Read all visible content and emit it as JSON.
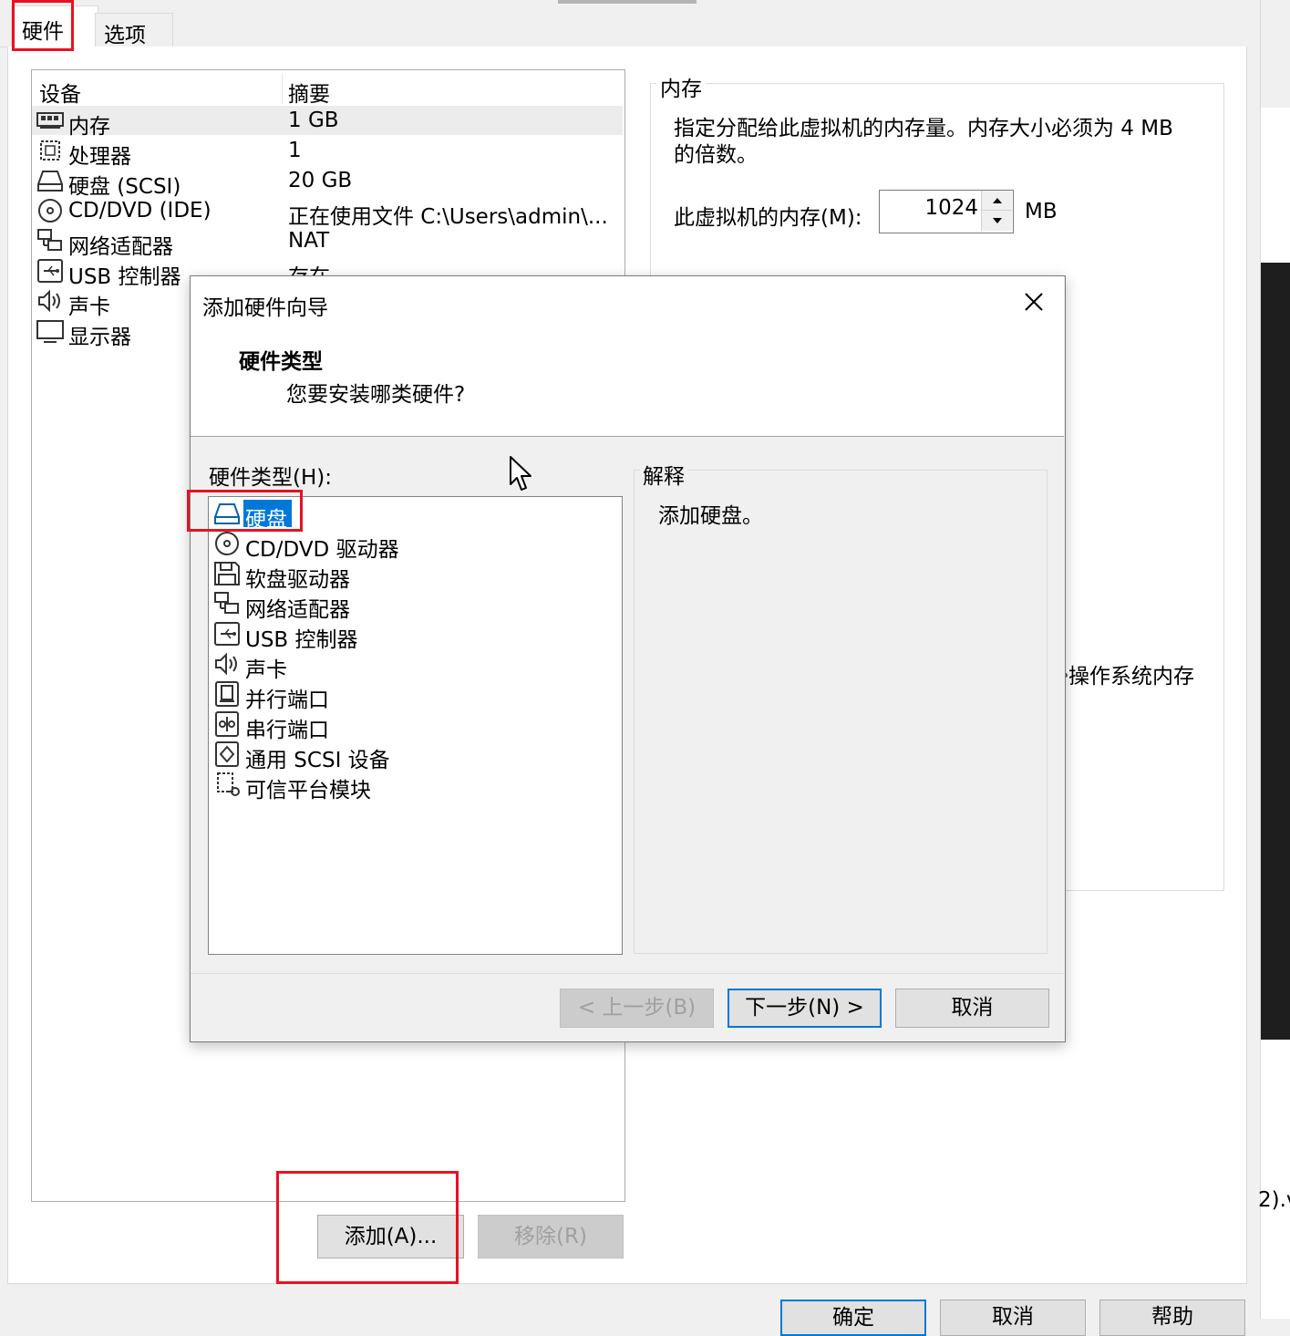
{
  "tabs": {
    "hardware": "硬件",
    "options": "选项"
  },
  "device_list": {
    "col_device": "设备",
    "col_summary": "摘要",
    "rows": [
      {
        "name": "内存",
        "summary": "1 GB",
        "icon": "memory-icon"
      },
      {
        "name": "处理器",
        "summary": "1",
        "icon": "processor-icon"
      },
      {
        "name": "硬盘 (SCSI)",
        "summary": "20 GB",
        "icon": "hard-disk-icon"
      },
      {
        "name": "CD/DVD (IDE)",
        "summary": "正在使用文件 C:\\Users\\admin\\...",
        "icon": "cd-dvd-icon"
      },
      {
        "name": "网络适配器",
        "summary": "NAT",
        "icon": "network-adapter-icon"
      },
      {
        "name": "USB 控制器",
        "summary": "存在",
        "icon": "usb-icon"
      },
      {
        "name": "声卡",
        "summary": "",
        "icon": "sound-card-icon"
      },
      {
        "name": "显示器",
        "summary": "",
        "icon": "display-icon"
      }
    ]
  },
  "memory": {
    "group_title": "内存",
    "description_line1": "指定分配给此虚拟机的内存量。内存大小必须为 4 MB",
    "description_line2": "的倍数。",
    "field_label": "此虚拟机的内存(M):",
    "value": "1024",
    "unit": "MB",
    "partial_note": "操作系统内存"
  },
  "bottom_buttons": {
    "add": "添加(A)...",
    "remove": "移除(R)"
  },
  "window_buttons": {
    "ok": "确定",
    "cancel": "取消",
    "help": "帮助"
  },
  "right_edge_text": "2).v",
  "dialog": {
    "title": "添加硬件向导",
    "heading": "硬件类型",
    "subheading": "您要安装哪类硬件?",
    "list_label": "硬件类型(H):",
    "explain_label": "解释",
    "explain_text": "添加硬盘。",
    "items": [
      {
        "label": "硬盘",
        "icon": "hard-disk-icon",
        "selected": true
      },
      {
        "label": "CD/DVD 驱动器",
        "icon": "cd-dvd-icon",
        "selected": false
      },
      {
        "label": "软盘驱动器",
        "icon": "floppy-icon",
        "selected": false
      },
      {
        "label": "网络适配器",
        "icon": "network-adapter-icon",
        "selected": false
      },
      {
        "label": "USB 控制器",
        "icon": "usb-icon",
        "selected": false
      },
      {
        "label": "声卡",
        "icon": "sound-card-icon",
        "selected": false
      },
      {
        "label": "并行端口",
        "icon": "parallel-port-icon",
        "selected": false
      },
      {
        "label": "串行端口",
        "icon": "serial-port-icon",
        "selected": false
      },
      {
        "label": "通用 SCSI 设备",
        "icon": "scsi-icon",
        "selected": false
      },
      {
        "label": "可信平台模块",
        "icon": "tpm-icon",
        "selected": false
      }
    ],
    "buttons": {
      "back": "< 上一步(B)",
      "next": "下一步(N) >",
      "cancel": "取消"
    }
  }
}
